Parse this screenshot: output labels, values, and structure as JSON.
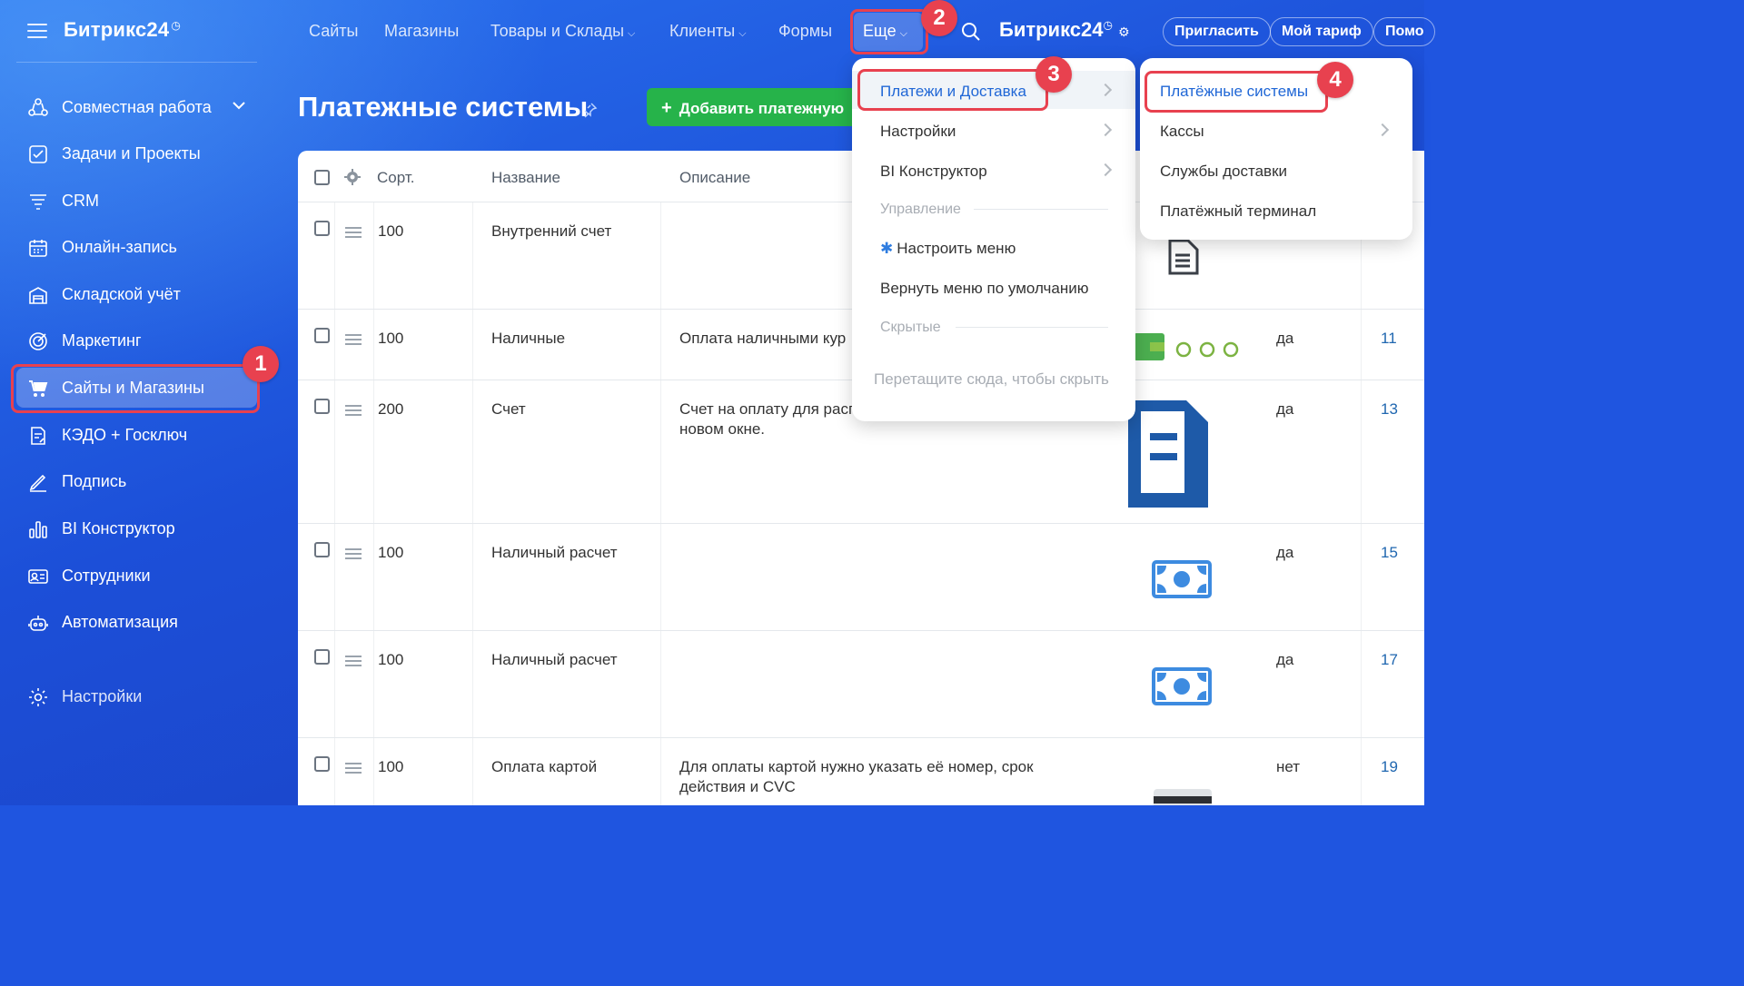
{
  "brand": {
    "name": "Битрикс24",
    "mark": "◷"
  },
  "sidebar": {
    "items": [
      {
        "label": "Совместная работа",
        "icon": "collaboration-icon"
      },
      {
        "label": "Задачи и Проекты",
        "icon": "tasks-icon"
      },
      {
        "label": "CRM",
        "icon": "crm-funnel-icon"
      },
      {
        "label": "Онлайн-запись",
        "icon": "calendar-icon"
      },
      {
        "label": "Складской учёт",
        "icon": "warehouse-icon"
      },
      {
        "label": "Маркетинг",
        "icon": "target-icon"
      },
      {
        "label": "Сайты и Магазины",
        "icon": "cart-icon"
      },
      {
        "label": "КЭДО + Госключ",
        "icon": "document-sign-icon"
      },
      {
        "label": "Подпись",
        "icon": "pen-icon"
      },
      {
        "label": "BI Конструктор",
        "icon": "bar-chart-icon"
      },
      {
        "label": "Сотрудники",
        "icon": "employees-icon"
      },
      {
        "label": "Автоматизация",
        "icon": "robot-icon"
      }
    ],
    "settings": "Настройки"
  },
  "topnav": {
    "items": [
      "Сайты",
      "Магазины",
      "Товары и Склады",
      "Клиенты",
      "Формы"
    ],
    "more": "Еще",
    "brand": "Битрикс24",
    "invite": "Пригласить",
    "tariff": "Мой тариф",
    "help": "Помо"
  },
  "page": {
    "title": "Платежные системы",
    "add_button": "Добавить платежную"
  },
  "table": {
    "headers": {
      "sort": "Сорт.",
      "name": "Название",
      "description": "Описание"
    },
    "rows": [
      {
        "sort": "100",
        "name": "Внутренний счет",
        "description": "",
        "active": "",
        "id": "",
        "logo": "document-logo-icon"
      },
      {
        "sort": "100",
        "name": "Наличные",
        "description": "Оплата наличными кур",
        "active": "да",
        "id": "11",
        "logo": "wallet-coins-logo-icon"
      },
      {
        "sort": "200",
        "name": "Счет",
        "description": "Счет на оплату для расп новом окне.",
        "desc_line1": "Счет на оплату для расп",
        "desc_line2": "новом окне.",
        "active": "да",
        "id": "13",
        "logo": "invoice-logo-icon"
      },
      {
        "sort": "100",
        "name": "Наличный расчет",
        "description": "",
        "active": "да",
        "id": "15",
        "logo": "cash-logo-icon"
      },
      {
        "sort": "100",
        "name": "Наличный расчет",
        "description": "",
        "active": "да",
        "id": "17",
        "logo": "cash-logo-icon"
      },
      {
        "sort": "100",
        "name": "Оплата картой",
        "description": "Для оплаты картой нужно указать её номер, срок действия и CVC",
        "desc_line1": "Для оплаты картой нужно указать её номер, срок",
        "desc_line2": "действия и CVC",
        "active": "нет",
        "id": "19",
        "logo": "card-logo-icon"
      }
    ]
  },
  "menu_more": {
    "items": [
      {
        "label": "Платежи и Доставка",
        "submenu": true
      },
      {
        "label": "Настройки",
        "submenu": true
      },
      {
        "label": "BI Конструктор",
        "submenu": true
      }
    ],
    "section_manage": "Управление",
    "configure": "Настроить меню",
    "reset": "Вернуть меню по умолчанию",
    "section_hidden": "Скрытые",
    "drop_hint": "Перетащите сюда, чтобы скрыть"
  },
  "menu_payments": {
    "items": [
      {
        "label": "Платёжные системы",
        "submenu": false
      },
      {
        "label": "Кассы",
        "submenu": true
      },
      {
        "label": "Службы доставки",
        "submenu": false
      },
      {
        "label": "Платёжный терминал",
        "submenu": false
      }
    ]
  },
  "annotations": [
    "1",
    "2",
    "3",
    "4"
  ],
  "colors": {
    "accent": "#2067d6",
    "highlight": "#e8414f",
    "add_button": "#26b34a",
    "sidebar_bg": "#1f55e0"
  }
}
